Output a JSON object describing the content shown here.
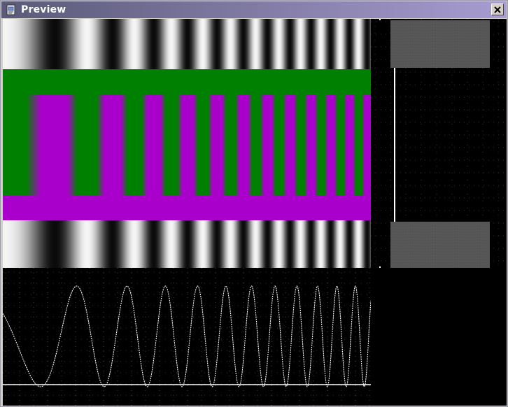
{
  "window": {
    "title": "Preview",
    "icon": "document-icon",
    "close_label": "Close"
  },
  "colors": {
    "titlebar_start": "#5a5a78",
    "titlebar_end": "#a89cd0",
    "green": "#008000",
    "magenta": "#aa00cc",
    "background": "#000000",
    "trace": "#ffffff"
  },
  "panels": {
    "gradient_top": "grayscale-chirp-band",
    "green_band": "solid-green-band",
    "chirp": "green-magenta-chirp-band",
    "magenta_band": "solid-magenta-band",
    "gradient_bottom": "grayscale-chirp-band",
    "side": "level-meter-panel",
    "waveform": "waveform-trace"
  }
}
